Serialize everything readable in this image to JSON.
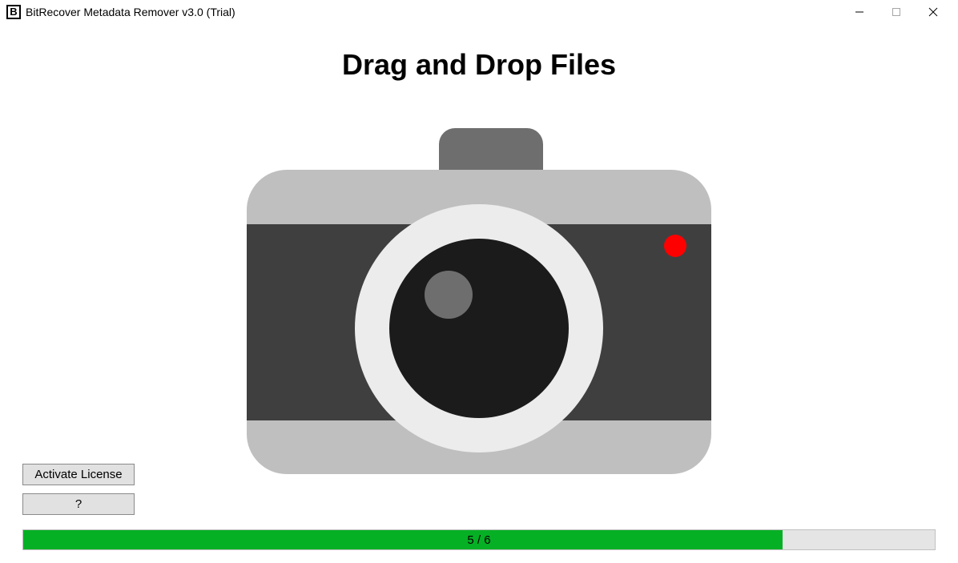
{
  "window": {
    "title": "BitRecover Metadata Remover v3.0 (Trial)",
    "icon_letter": "B"
  },
  "main": {
    "heading": "Drag and Drop Files"
  },
  "buttons": {
    "activate_license": "Activate License",
    "help": "?"
  },
  "progress": {
    "current": 5,
    "total": 6,
    "label": "5 / 6",
    "percent": 83.33
  }
}
